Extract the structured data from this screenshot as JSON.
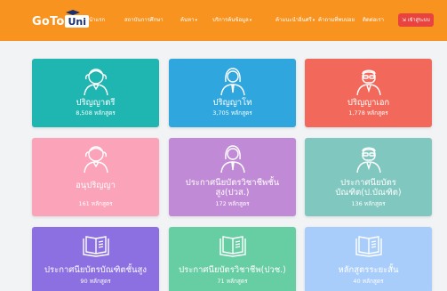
{
  "nav": {
    "logo_main": "GoTo",
    "logo_box": "Uni",
    "links": [
      "หน้าแรก",
      "สถาบันการศึกษา",
      "ค้นหา",
      "บริการค้นข้อมูล",
      "ค้าแนะนำอิ่นศรี",
      "ค้าถามที่พบบ่อย",
      "ติดต่อเรา"
    ],
    "login_label": "เข้าสู่ระบบ"
  },
  "colors": {
    "nav": "#f7931e",
    "login": "#e8433f"
  },
  "cards": [
    {
      "title": "ปริญญาตรี",
      "count": "8,508 หลักสูตร",
      "icon": "graduate-girl-icon",
      "color": "#1fb5b1"
    },
    {
      "title": "ปริญญาโท",
      "count": "3,705 หลักสูตร",
      "icon": "woman-tie-icon",
      "color": "#2fa6de"
    },
    {
      "title": "ปริญญาเอก",
      "count": "1,778 หลักสูตร",
      "icon": "man-glasses-icon",
      "color": "#f2685a"
    },
    {
      "title": "อนุปริญญา",
      "count": "161 หลักสูตร",
      "icon": "graduate-girl-icon",
      "color": "#fba3b9"
    },
    {
      "title": "ประกาศนียบัตรวิชาชีพชั้น สูง(ปวส.)",
      "count": "172 หลักสูตร",
      "icon": "woman-tie-icon",
      "color": "#c18ad6"
    },
    {
      "title": "ประกาศนียบัตร บัณฑิต(ป.บัณฑิต)",
      "count": "136 หลักสูตร",
      "icon": "man-glasses-icon",
      "color": "#7fc7bf"
    },
    {
      "title": "ประกาศนียบัตรบัณฑิตชั้นสูง",
      "count": "90 หลักสูตร",
      "icon": "book-icon",
      "color": "#8c6fe0"
    },
    {
      "title": "ประกาศนียบัตรวิชาชีพ(ปวช.)",
      "count": "71 หลักสูตร",
      "icon": "book-icon",
      "color": "#67cda3"
    },
    {
      "title": "หลักสูตรระยะสั้น",
      "count": "40 หลักสูตร",
      "icon": "book-icon",
      "color": "#a9cdfb"
    }
  ]
}
